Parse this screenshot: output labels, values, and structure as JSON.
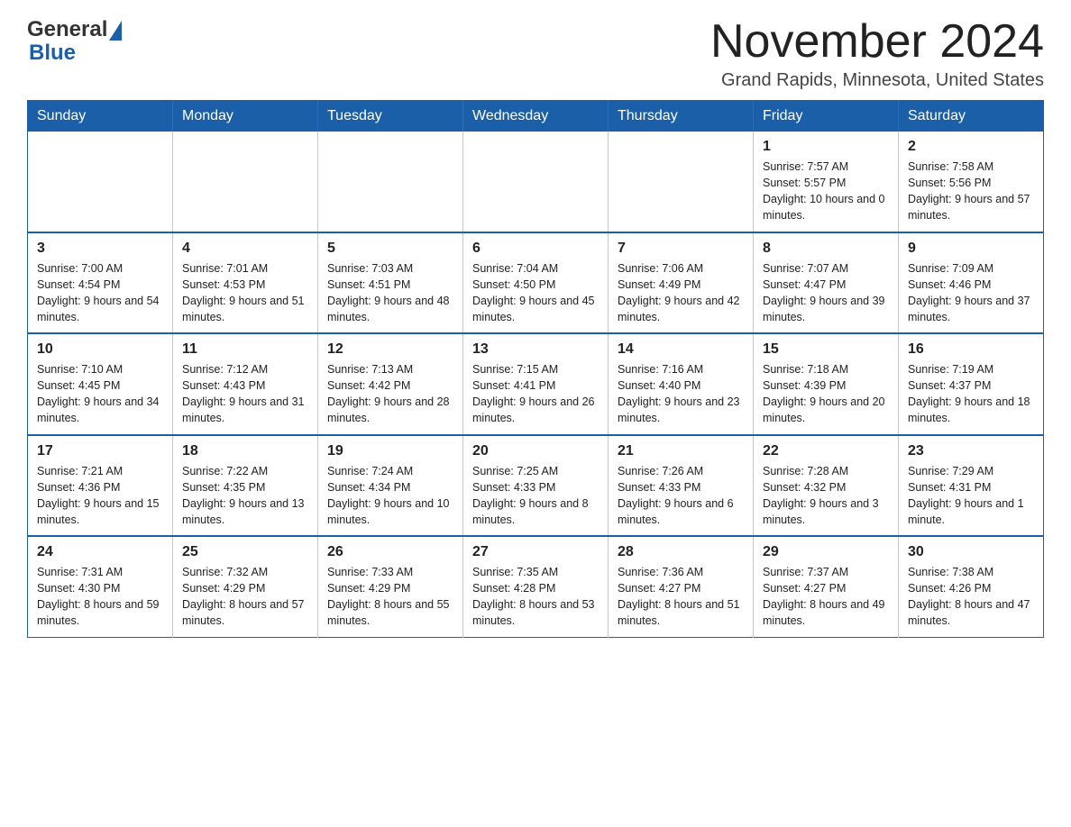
{
  "header": {
    "logo_general": "General",
    "logo_blue": "Blue",
    "month_title": "November 2024",
    "location": "Grand Rapids, Minnesota, United States"
  },
  "weekdays": [
    "Sunday",
    "Monday",
    "Tuesday",
    "Wednesday",
    "Thursday",
    "Friday",
    "Saturday"
  ],
  "weeks": [
    [
      {
        "day": "",
        "info": ""
      },
      {
        "day": "",
        "info": ""
      },
      {
        "day": "",
        "info": ""
      },
      {
        "day": "",
        "info": ""
      },
      {
        "day": "",
        "info": ""
      },
      {
        "day": "1",
        "info": "Sunrise: 7:57 AM\nSunset: 5:57 PM\nDaylight: 10 hours and 0 minutes."
      },
      {
        "day": "2",
        "info": "Sunrise: 7:58 AM\nSunset: 5:56 PM\nDaylight: 9 hours and 57 minutes."
      }
    ],
    [
      {
        "day": "3",
        "info": "Sunrise: 7:00 AM\nSunset: 4:54 PM\nDaylight: 9 hours and 54 minutes."
      },
      {
        "day": "4",
        "info": "Sunrise: 7:01 AM\nSunset: 4:53 PM\nDaylight: 9 hours and 51 minutes."
      },
      {
        "day": "5",
        "info": "Sunrise: 7:03 AM\nSunset: 4:51 PM\nDaylight: 9 hours and 48 minutes."
      },
      {
        "day": "6",
        "info": "Sunrise: 7:04 AM\nSunset: 4:50 PM\nDaylight: 9 hours and 45 minutes."
      },
      {
        "day": "7",
        "info": "Sunrise: 7:06 AM\nSunset: 4:49 PM\nDaylight: 9 hours and 42 minutes."
      },
      {
        "day": "8",
        "info": "Sunrise: 7:07 AM\nSunset: 4:47 PM\nDaylight: 9 hours and 39 minutes."
      },
      {
        "day": "9",
        "info": "Sunrise: 7:09 AM\nSunset: 4:46 PM\nDaylight: 9 hours and 37 minutes."
      }
    ],
    [
      {
        "day": "10",
        "info": "Sunrise: 7:10 AM\nSunset: 4:45 PM\nDaylight: 9 hours and 34 minutes."
      },
      {
        "day": "11",
        "info": "Sunrise: 7:12 AM\nSunset: 4:43 PM\nDaylight: 9 hours and 31 minutes."
      },
      {
        "day": "12",
        "info": "Sunrise: 7:13 AM\nSunset: 4:42 PM\nDaylight: 9 hours and 28 minutes."
      },
      {
        "day": "13",
        "info": "Sunrise: 7:15 AM\nSunset: 4:41 PM\nDaylight: 9 hours and 26 minutes."
      },
      {
        "day": "14",
        "info": "Sunrise: 7:16 AM\nSunset: 4:40 PM\nDaylight: 9 hours and 23 minutes."
      },
      {
        "day": "15",
        "info": "Sunrise: 7:18 AM\nSunset: 4:39 PM\nDaylight: 9 hours and 20 minutes."
      },
      {
        "day": "16",
        "info": "Sunrise: 7:19 AM\nSunset: 4:37 PM\nDaylight: 9 hours and 18 minutes."
      }
    ],
    [
      {
        "day": "17",
        "info": "Sunrise: 7:21 AM\nSunset: 4:36 PM\nDaylight: 9 hours and 15 minutes."
      },
      {
        "day": "18",
        "info": "Sunrise: 7:22 AM\nSunset: 4:35 PM\nDaylight: 9 hours and 13 minutes."
      },
      {
        "day": "19",
        "info": "Sunrise: 7:24 AM\nSunset: 4:34 PM\nDaylight: 9 hours and 10 minutes."
      },
      {
        "day": "20",
        "info": "Sunrise: 7:25 AM\nSunset: 4:33 PM\nDaylight: 9 hours and 8 minutes."
      },
      {
        "day": "21",
        "info": "Sunrise: 7:26 AM\nSunset: 4:33 PM\nDaylight: 9 hours and 6 minutes."
      },
      {
        "day": "22",
        "info": "Sunrise: 7:28 AM\nSunset: 4:32 PM\nDaylight: 9 hours and 3 minutes."
      },
      {
        "day": "23",
        "info": "Sunrise: 7:29 AM\nSunset: 4:31 PM\nDaylight: 9 hours and 1 minute."
      }
    ],
    [
      {
        "day": "24",
        "info": "Sunrise: 7:31 AM\nSunset: 4:30 PM\nDaylight: 8 hours and 59 minutes."
      },
      {
        "day": "25",
        "info": "Sunrise: 7:32 AM\nSunset: 4:29 PM\nDaylight: 8 hours and 57 minutes."
      },
      {
        "day": "26",
        "info": "Sunrise: 7:33 AM\nSunset: 4:29 PM\nDaylight: 8 hours and 55 minutes."
      },
      {
        "day": "27",
        "info": "Sunrise: 7:35 AM\nSunset: 4:28 PM\nDaylight: 8 hours and 53 minutes."
      },
      {
        "day": "28",
        "info": "Sunrise: 7:36 AM\nSunset: 4:27 PM\nDaylight: 8 hours and 51 minutes."
      },
      {
        "day": "29",
        "info": "Sunrise: 7:37 AM\nSunset: 4:27 PM\nDaylight: 8 hours and 49 minutes."
      },
      {
        "day": "30",
        "info": "Sunrise: 7:38 AM\nSunset: 4:26 PM\nDaylight: 8 hours and 47 minutes."
      }
    ]
  ]
}
